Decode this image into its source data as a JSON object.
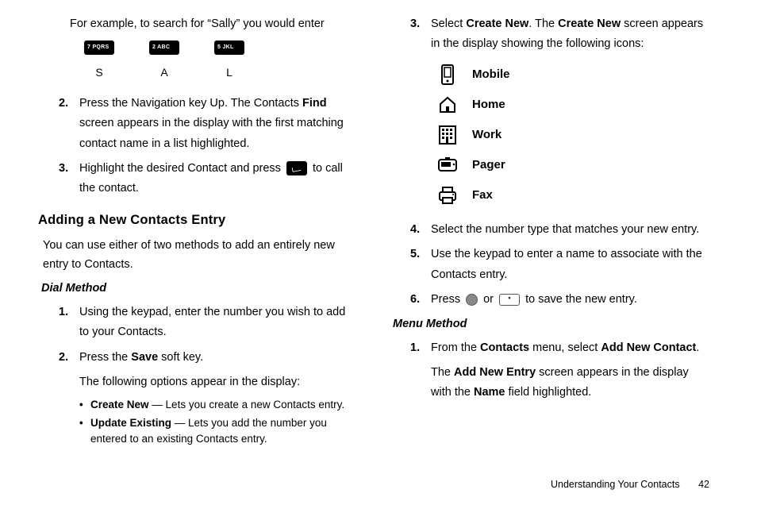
{
  "left": {
    "intro": "For example, to search for “Sally” you would enter",
    "keys": [
      {
        "cap": "7 PQRS",
        "letter": "S"
      },
      {
        "cap": "2 ABC",
        "letter": "A"
      },
      {
        "cap": "5 JKL",
        "letter": "L"
      }
    ],
    "step2_a": "Press the Navigation key Up. The Contacts ",
    "step2_b": "Find",
    "step2_c": " screen appears in the display with the first matching contact name in a list highlighted.",
    "step3_a": "Highlight the desired Contact and press ",
    "step3_b": " to call the contact.",
    "h1": "Adding a New Contacts Entry",
    "sub": "You can use either of two methods to add an entirely new entry to Contacts.",
    "h2": "Dial Method",
    "dm1": "Using the keypad, enter the number you wish to add to your Contacts.",
    "dm2_a": "Press the ",
    "dm2_b": "Save",
    "dm2_c": " soft key.",
    "dm2_d": "The following options appear in the display:",
    "b1_a": "Create New",
    "b1_b": " — Lets you create a new Contacts entry.",
    "b2_a": "Update Existing",
    "b2_b": " — Lets you add the number you entered to an existing Contacts entry."
  },
  "right": {
    "step3_a": "Select ",
    "step3_b": "Create New",
    "step3_c": ". The ",
    "step3_d": "Create New",
    "step3_e": " screen appears in the display showing the following icons:",
    "icons": [
      {
        "name": "mobile-icon",
        "label": "Mobile"
      },
      {
        "name": "home-icon",
        "label": "Home"
      },
      {
        "name": "work-icon",
        "label": "Work"
      },
      {
        "name": "pager-icon",
        "label": "Pager"
      },
      {
        "name": "fax-icon",
        "label": "Fax"
      }
    ],
    "step4": " Select the number type that matches your new entry.",
    "step5": "Use the keypad to enter a name to associate with the Contacts entry.",
    "step6_a": "Press ",
    "step6_b": " or ",
    "step6_c": " to save the new entry.",
    "h2": "Menu Method",
    "mm1_a": "From the ",
    "mm1_b": "Contacts",
    "mm1_c": " menu, select ",
    "mm1_d": "Add New Contact",
    "mm1_e": ".",
    "mm1_f_a": "The ",
    "mm1_f_b": "Add New Entry",
    "mm1_f_c": " screen appears in the display with the ",
    "mm1_f_d": "Name",
    "mm1_f_e": " field highlighted."
  },
  "footer": {
    "section": "Understanding Your Contacts",
    "page": "42"
  },
  "nums": {
    "n1": "1.",
    "n2": "2.",
    "n3": "3.",
    "n4": "4.",
    "n5": "5.",
    "n6": "6."
  },
  "dot": "•"
}
